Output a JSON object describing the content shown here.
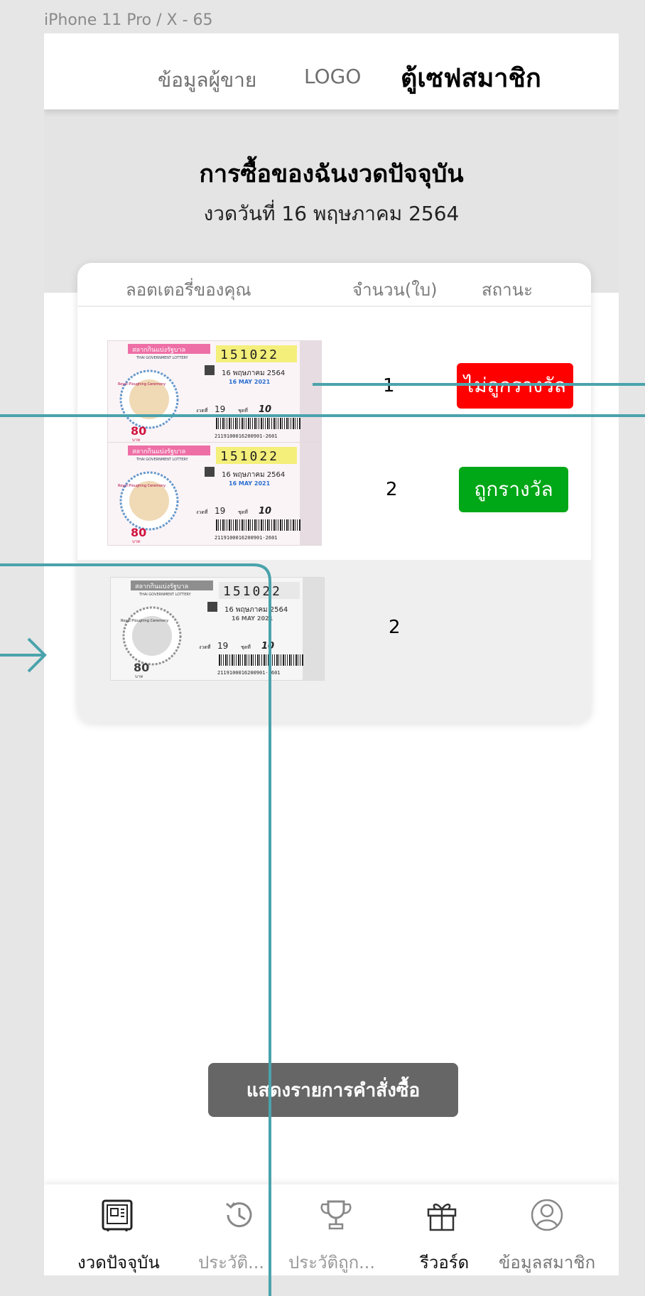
{
  "frame": {
    "label": "iPhone 11 Pro / X - 65"
  },
  "header": {
    "seller_label": "ข้อมูลผู้ขาย",
    "logo_label": "LOGO",
    "safe_label": "ตู้เซฟสมาชิก"
  },
  "banner": {
    "title": "การซื้อของฉันงวดปัจจุบัน",
    "subtitle": "งวดวันที่ 16 พฤษภาคม 2564"
  },
  "table": {
    "columns": {
      "lottery": "ลอตเตอรี่ของคุณ",
      "qty": "จำนวน(ใบ)",
      "status": "สถานะ"
    },
    "rows": [
      {
        "qty": "1",
        "status": "ไม่ถูกรางวัล",
        "status_color": "#ff0000"
      },
      {
        "qty": "2",
        "status": "ถูกรางวัล",
        "status_color": "#00a716"
      },
      {
        "qty": "2",
        "status": ""
      }
    ]
  },
  "ticket": {
    "number": "151022",
    "number_sub": "one five one zero two two",
    "header_th": "สลากกินแบ่งรัฐบาล",
    "header_en": "THAI GOVERNMENT LOTTERY",
    "date_th": "16 พฤษภาคม 2564",
    "date_en": "16 MAY 2021",
    "draw_label": "งวดที่",
    "draw_no": "19",
    "set_label": "ชุดที่",
    "set_no": "10",
    "price": "80",
    "price_unit": "บาท",
    "barcode": "2119100016200901-2601",
    "small_caption": "Royal Ploughing Ceremony"
  },
  "order_button": {
    "label": "แสดงรายการคำสั่งซื้อ"
  },
  "bottom_nav": [
    {
      "label": "งวดปัจจุบัน",
      "icon": "safe-icon",
      "active": true
    },
    {
      "label": "ประวัติ...",
      "icon": "history-icon",
      "active": false
    },
    {
      "label": "ประวัติถูก...",
      "icon": "trophy-icon",
      "active": false
    },
    {
      "label": "รีวอร์ด",
      "icon": "gift-icon",
      "active": true
    },
    {
      "label": "ข้อมูลสมาชิก",
      "icon": "user-icon",
      "active": false
    }
  ],
  "colors": {
    "prototype_line": "#4aa3ac",
    "not_won": "#ff0000",
    "won": "#00a716",
    "button": "#666666"
  }
}
